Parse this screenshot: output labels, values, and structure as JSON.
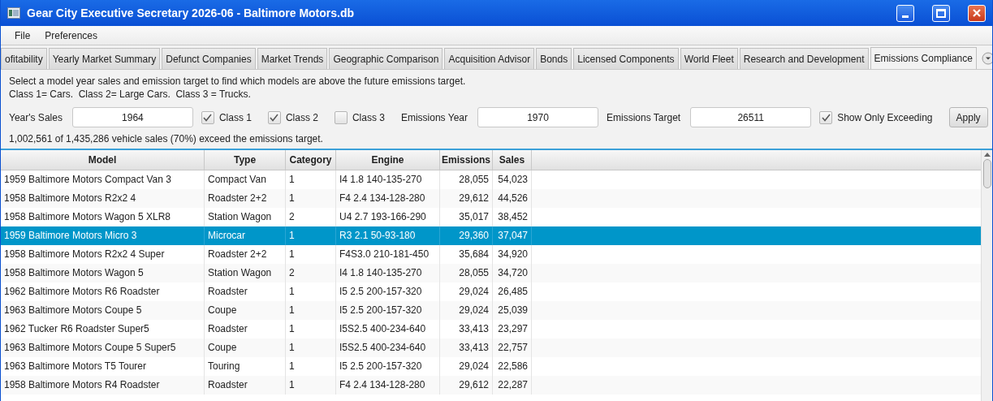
{
  "window": {
    "title": "Gear City Executive Secretary 2026-06 - Baltimore Motors.db"
  },
  "menu": [
    "File",
    "Preferences"
  ],
  "tabs": [
    {
      "label": "ofitability",
      "selected": false
    },
    {
      "label": "Yearly Market Summary",
      "selected": false
    },
    {
      "label": "Defunct Companies",
      "selected": false
    },
    {
      "label": "Market Trends",
      "selected": false
    },
    {
      "label": "Geographic Comparison",
      "selected": false
    },
    {
      "label": "Acquisition Advisor",
      "selected": false
    },
    {
      "label": "Bonds",
      "selected": false
    },
    {
      "label": "Licensed Components",
      "selected": false
    },
    {
      "label": "World Fleet",
      "selected": false
    },
    {
      "label": "Research and Development",
      "selected": false
    },
    {
      "label": "Emissions Compliance",
      "selected": true
    }
  ],
  "instructions": [
    "Select a model year sales and emission target to find which models are above the future emissions target.",
    "Class 1= Cars.  Class 2= Large Cars.  Class 3 = Trucks."
  ],
  "controls": [
    {
      "kind": "field",
      "label": "Year's Sales",
      "value": "1964"
    },
    {
      "kind": "checkbox",
      "label": "Class 1",
      "checked": true
    },
    {
      "kind": "checkbox",
      "label": "Class 2",
      "checked": true
    },
    {
      "kind": "checkbox",
      "label": "Class 3",
      "checked": false
    },
    {
      "kind": "field",
      "label": "Emissions Year",
      "value": "1970"
    },
    {
      "kind": "field",
      "label": "Emissions Target",
      "value": "26511"
    },
    {
      "kind": "checkbox",
      "label": "Show Only Exceeding",
      "checked": true
    },
    {
      "kind": "button",
      "label": "Apply"
    }
  ],
  "summary": "1,002,561 of 1,435,286 vehicle sales (70%) exceed the emissions target.",
  "table": {
    "columns": [
      "Model",
      "Type",
      "Category",
      "Engine",
      "Emissions",
      "Sales"
    ],
    "rows": [
      {
        "cells": [
          "1959 Baltimore Motors Compact Van 3",
          "Compact Van",
          "1",
          "I4 1.8 140-135-270",
          "28,055",
          "54,023"
        ],
        "selected": false
      },
      {
        "cells": [
          "1958 Baltimore Motors R2x2 4",
          "Roadster 2+2",
          "1",
          "F4 2.4 134-128-280",
          "29,612",
          "44,526"
        ],
        "selected": false
      },
      {
        "cells": [
          "1958 Baltimore Motors Wagon 5 XLR8",
          "Station Wagon",
          "2",
          "U4 2.7 193-166-290",
          "35,017",
          "38,452"
        ],
        "selected": false
      },
      {
        "cells": [
          "1959 Baltimore Motors Micro 3",
          "Microcar",
          "1",
          "R3 2.1 50-93-180",
          "29,360",
          "37,047"
        ],
        "selected": true
      },
      {
        "cells": [
          "1958 Baltimore Motors R2x2 4 Super",
          "Roadster 2+2",
          "1",
          "F4S3.0 210-181-450",
          "35,684",
          "34,920"
        ],
        "selected": false
      },
      {
        "cells": [
          "1958 Baltimore Motors Wagon 5",
          "Station Wagon",
          "2",
          "I4 1.8 140-135-270",
          "28,055",
          "34,720"
        ],
        "selected": false
      },
      {
        "cells": [
          "1962 Baltimore Motors R6 Roadster",
          "Roadster",
          "1",
          "I5 2.5 200-157-320",
          "29,024",
          "26,485"
        ],
        "selected": false
      },
      {
        "cells": [
          "1963 Baltimore Motors Coupe 5",
          "Coupe",
          "1",
          "I5 2.5 200-157-320",
          "29,024",
          "25,039"
        ],
        "selected": false
      },
      {
        "cells": [
          "1962 Tucker R6 Roadster Super5",
          "Roadster",
          "1",
          "I5S2.5 400-234-640",
          "33,413",
          "23,297"
        ],
        "selected": false
      },
      {
        "cells": [
          "1963 Baltimore Motors Coupe 5 Super5",
          "Coupe",
          "1",
          "I5S2.5 400-234-640",
          "33,413",
          "22,757"
        ],
        "selected": false
      },
      {
        "cells": [
          "1963 Baltimore Motors T5 Tourer",
          "Touring",
          "1",
          "I5 2.5 200-157-320",
          "29,024",
          "22,586"
        ],
        "selected": false
      },
      {
        "cells": [
          "1958 Baltimore Motors R4 Roadster",
          "Roadster",
          "1",
          "F4 2.4 134-128-280",
          "29,612",
          "22,287"
        ],
        "selected": false
      }
    ]
  }
}
